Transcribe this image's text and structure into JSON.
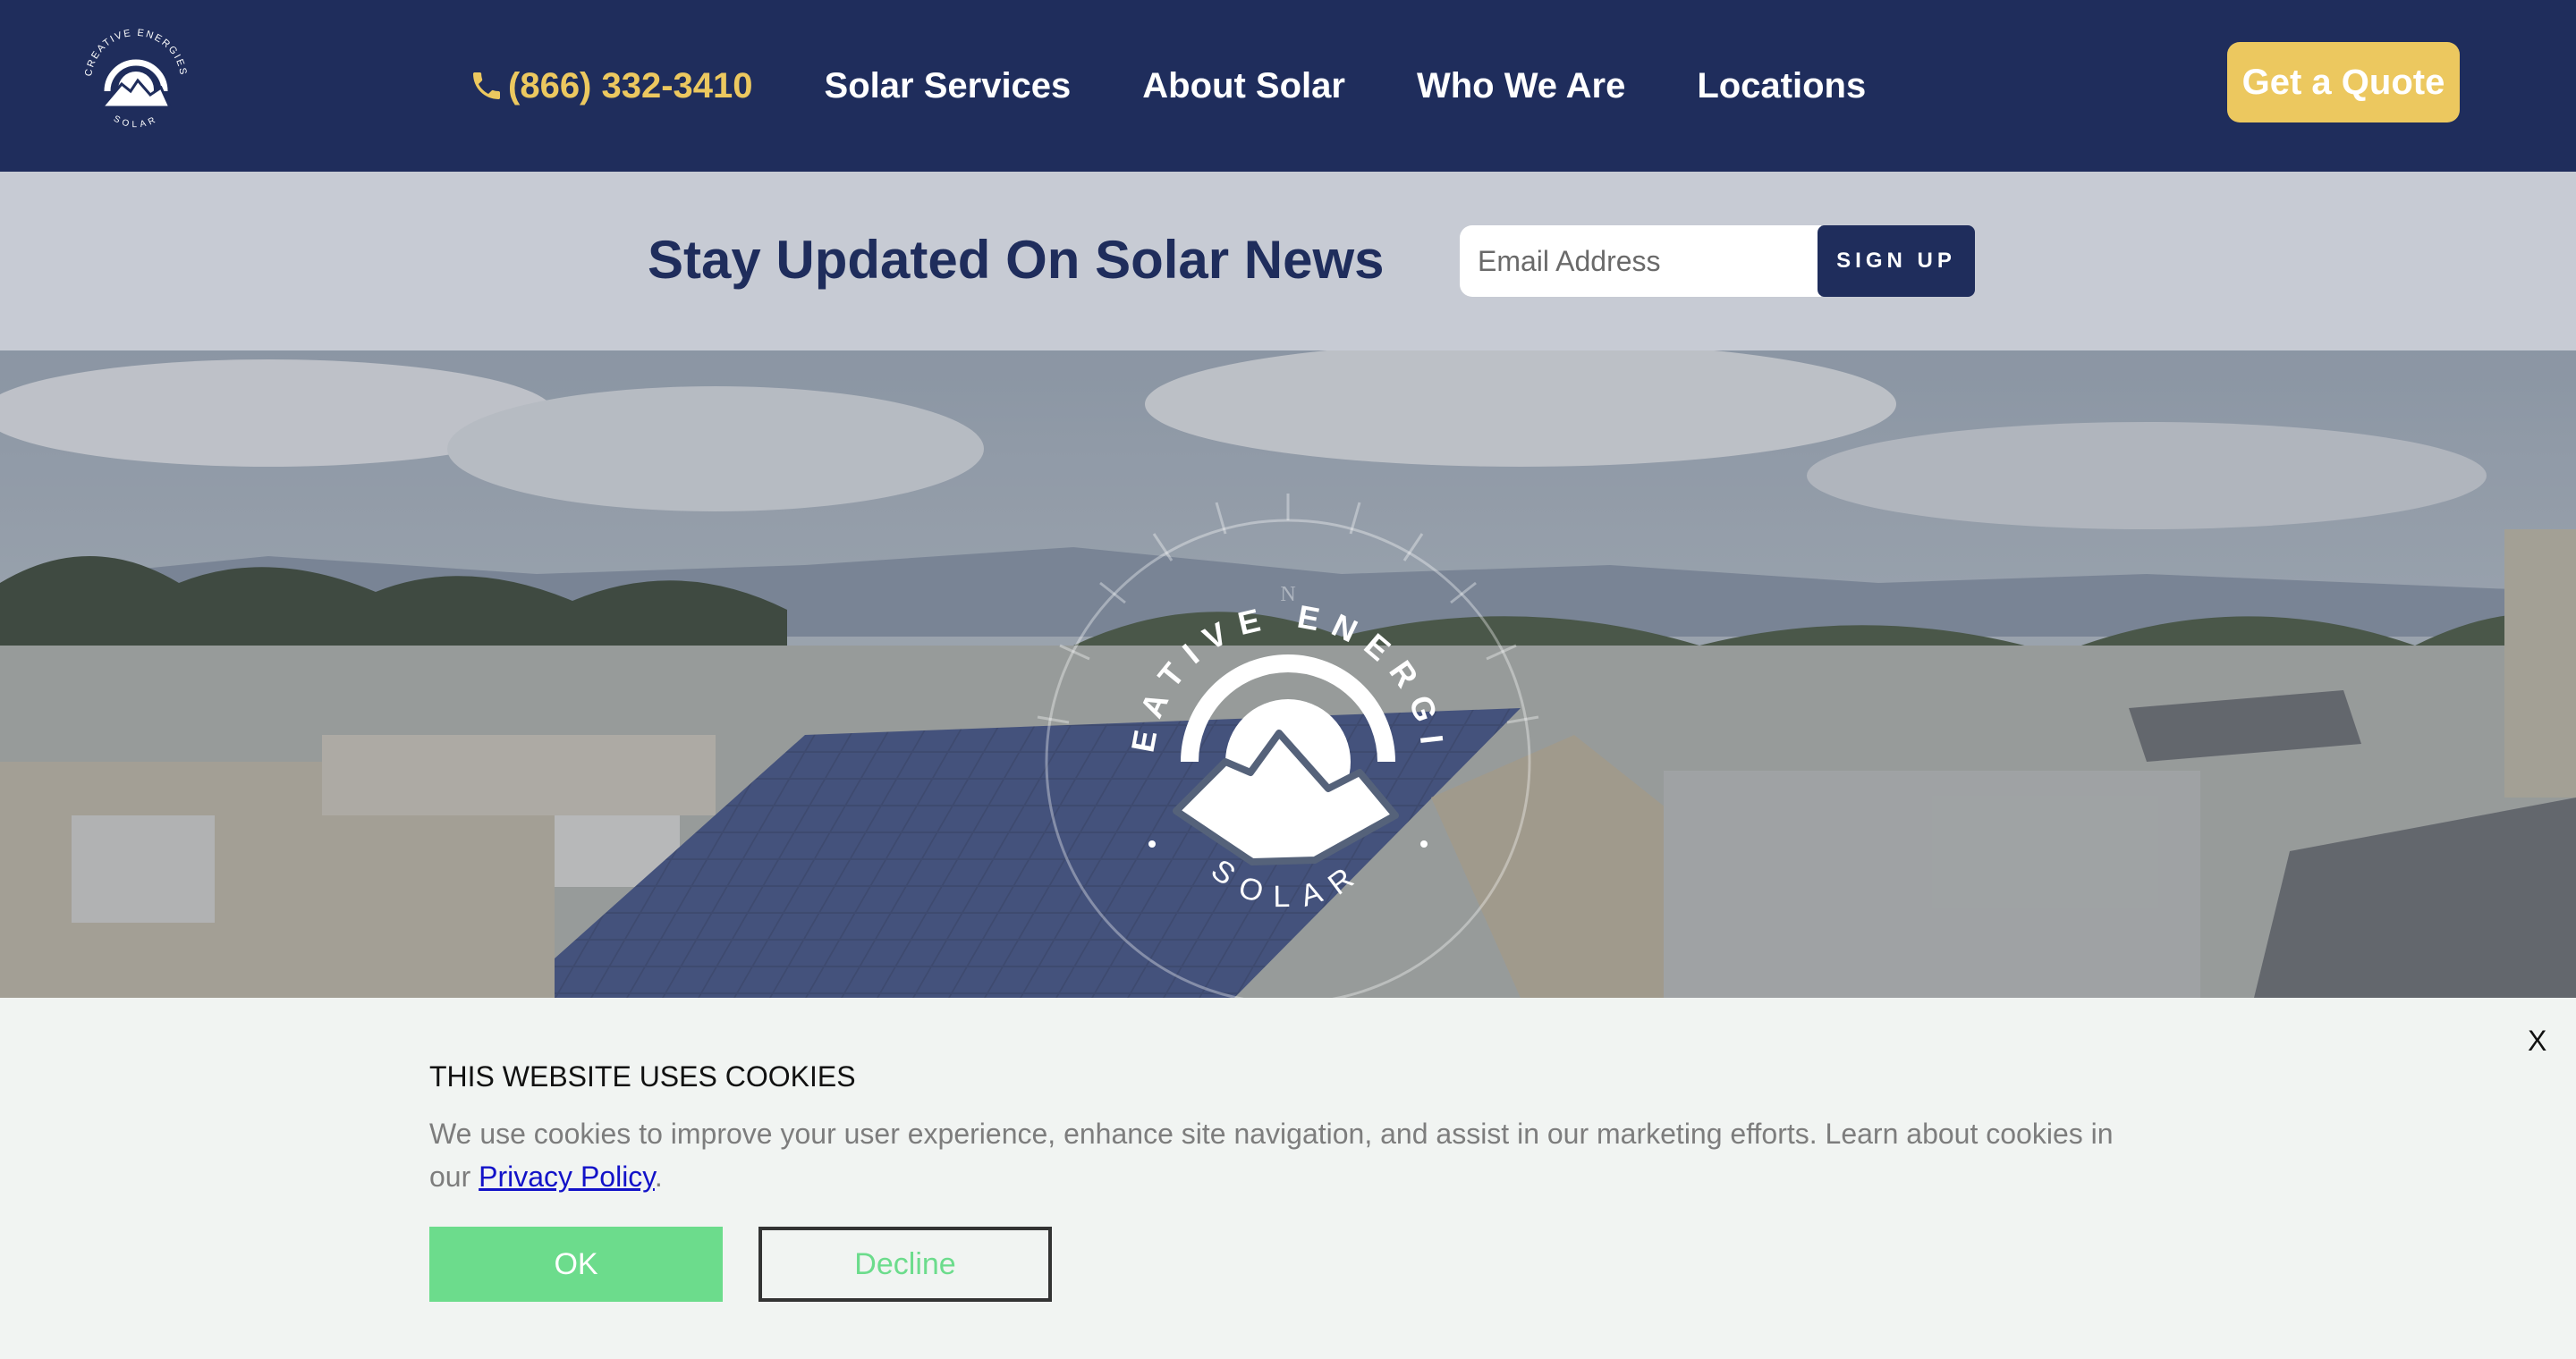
{
  "header": {
    "logo": {
      "icon": "creative-energies-solar-logo",
      "text_top": "CREATIVE ENERGIES",
      "text_bottom": "SOLAR"
    },
    "phone": {
      "icon": "phone-icon",
      "label": "(866) 332-3410"
    },
    "nav": [
      {
        "label": "Solar Services"
      },
      {
        "label": "About Solar"
      },
      {
        "label": "Who We Are"
      },
      {
        "label": "Locations"
      }
    ],
    "quote_button": "Get a Quote"
  },
  "newsletter": {
    "title": "Stay Updated On Solar News",
    "email_placeholder": "Email Address",
    "signup_button": "SIGN UP"
  },
  "hero": {
    "emblem_top": "CREATIVE ENERGIES",
    "emblem_bottom": "SOLAR",
    "compass": "N"
  },
  "cookie_banner": {
    "close": "X",
    "title": "THIS WEBSITE USES COOKIES",
    "text_before_link": "We use cookies to improve your user experience, enhance site navigation, and assist in our marketing efforts. Learn about cookies in our ",
    "link_text": "Privacy Policy",
    "text_after_link": ".",
    "ok_button": "OK",
    "decline_button": "Decline"
  },
  "colors": {
    "navy": "#1f2d5c",
    "gold": "#ecc85f",
    "newsletter_bg": "#c7cbd4",
    "cookie_bg": "#f1f4f2",
    "green": "#6cdc8c"
  }
}
